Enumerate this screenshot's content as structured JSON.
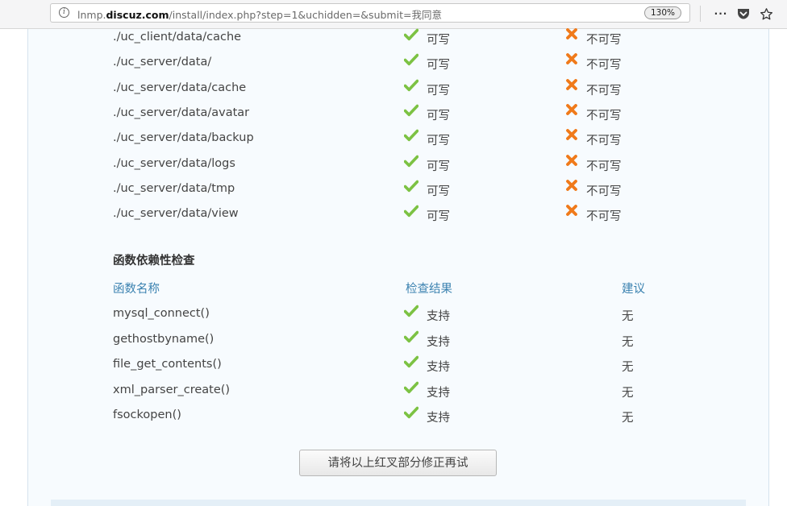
{
  "browser": {
    "url_prefix": "lnmp.",
    "url_domain": "discuz.com",
    "url_path": "/install/index.php?step=1&uchidden=&submit=我同意",
    "zoom": "130%",
    "more_icon": "more-icon",
    "pocket_icon": "pocket-icon",
    "bookmark_icon": "bookmark-star-icon",
    "dots": "···"
  },
  "dir_rows": [
    {
      "path": "./uc_client/data/cache",
      "ok": "可写",
      "bad": "不可写"
    },
    {
      "path": "./uc_server/data/",
      "ok": "可写",
      "bad": "不可写"
    },
    {
      "path": "./uc_server/data/cache",
      "ok": "可写",
      "bad": "不可写"
    },
    {
      "path": "./uc_server/data/avatar",
      "ok": "可写",
      "bad": "不可写"
    },
    {
      "path": "./uc_server/data/backup",
      "ok": "可写",
      "bad": "不可写"
    },
    {
      "path": "./uc_server/data/logs",
      "ok": "可写",
      "bad": "不可写"
    },
    {
      "path": "./uc_server/data/tmp",
      "ok": "可写",
      "bad": "不可写"
    },
    {
      "path": "./uc_server/data/view",
      "ok": "可写",
      "bad": "不可写"
    }
  ],
  "func_section": {
    "title": "函数依赖性检查",
    "headers": {
      "name": "函数名称",
      "result": "检查结果",
      "suggestion": "建议"
    },
    "rows": [
      {
        "name": "mysql_connect()",
        "result": "支持",
        "suggestion": "无"
      },
      {
        "name": "gethostbyname()",
        "result": "支持",
        "suggestion": "无"
      },
      {
        "name": "file_get_contents()",
        "result": "支持",
        "suggestion": "无"
      },
      {
        "name": "xml_parser_create()",
        "result": "支持",
        "suggestion": "无"
      },
      {
        "name": "fsockopen()",
        "result": "支持",
        "suggestion": "无"
      }
    ]
  },
  "retry_button": "请将以上红叉部分修正再试",
  "colors": {
    "check": "#7cc243",
    "cross": "#f07a1a",
    "header": "#3b82b0"
  }
}
